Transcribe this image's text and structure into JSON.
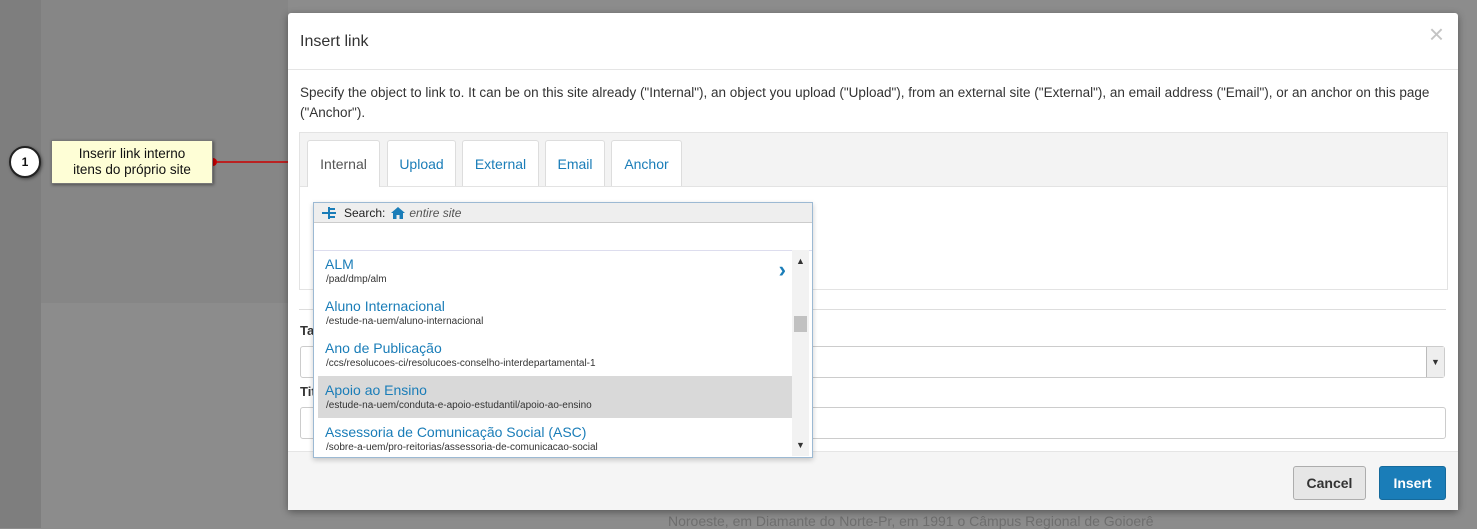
{
  "background": {
    "footer_text": "Noroeste, em Diamante do Norte-Pr, em 1991 o Câmpus Regional de Goioerê"
  },
  "annotation": {
    "number": "1",
    "text_line1": "Inserir link interno",
    "text_line2": "itens do próprio site"
  },
  "modal": {
    "title": "Insert link",
    "close_icon": "×",
    "description": "Specify the object to link to. It can be on this site already (\"Internal\"), an object you upload (\"Upload\"), from an external site (\"External\"), an email address (\"Email\"), or an anchor on this page (\"Anchor\").",
    "tabs": [
      {
        "label": "Internal",
        "active": true
      },
      {
        "label": "Upload",
        "active": false
      },
      {
        "label": "External",
        "active": false
      },
      {
        "label": "Email",
        "active": false
      },
      {
        "label": "Anchor",
        "active": false
      }
    ],
    "fields": {
      "target_label_partial": "Ta",
      "title_label_partial": "Tit"
    },
    "buttons": {
      "cancel": "Cancel",
      "insert": "Insert"
    }
  },
  "search": {
    "label": "Search:",
    "scope": "entire site",
    "value": "",
    "results": [
      {
        "title": "ALM",
        "path": "/pad/dmp/alm",
        "has_children": true,
        "highlighted": false
      },
      {
        "title": "Aluno Internacional",
        "path": "/estude-na-uem/aluno-internacional",
        "has_children": false,
        "highlighted": false
      },
      {
        "title": "Ano de Publicação",
        "path": "/ccs/resolucoes-ci/resolucoes-conselho-interdepartamental-1",
        "has_children": false,
        "highlighted": false
      },
      {
        "title": "Apoio ao Ensino",
        "path": "/estude-na-uem/conduta-e-apoio-estudantil/apoio-ao-ensino",
        "has_children": false,
        "highlighted": true
      },
      {
        "title": "Assessoria de Comunicação Social (ASC)",
        "path": "/sobre-a-uem/pro-reitorias/assessoria-de-comunicacao-social",
        "has_children": false,
        "highlighted": false
      }
    ]
  },
  "colors": {
    "accent": "#1a7db8",
    "highlight": "#d9d9d9",
    "callout": "#fefed6",
    "arrow": "#cc0000"
  }
}
